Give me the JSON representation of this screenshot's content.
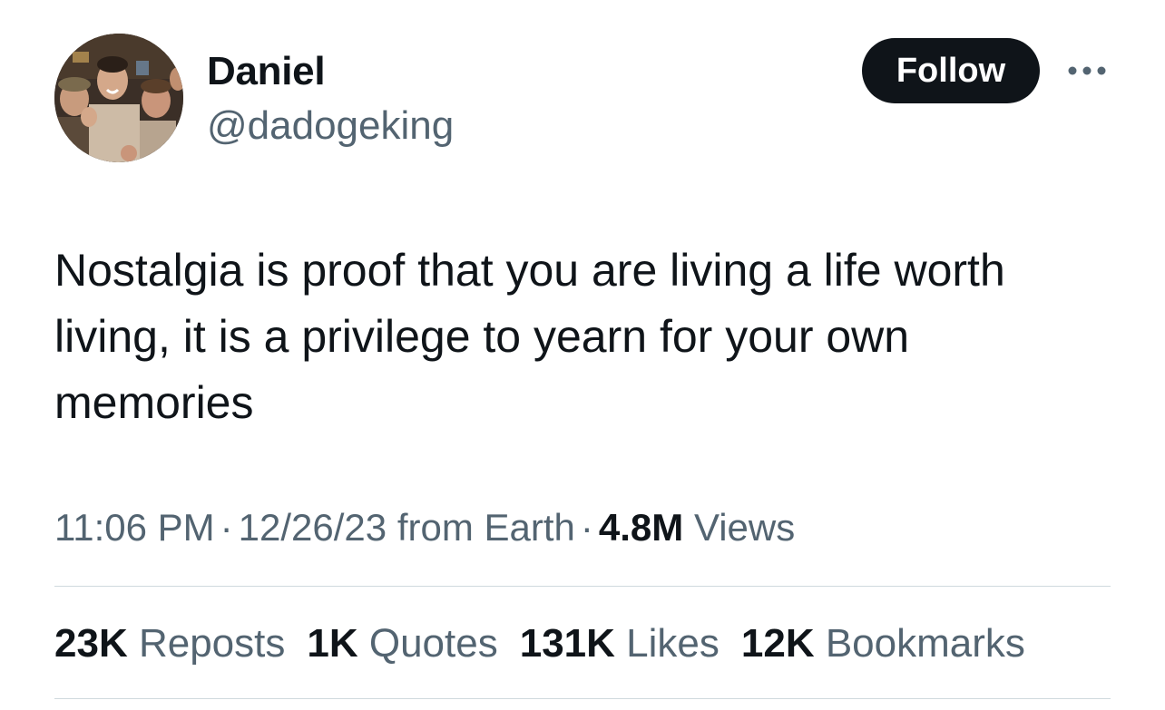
{
  "author": {
    "name": "Daniel",
    "handle": "@dadogeking"
  },
  "actions": {
    "follow_label": "Follow",
    "more_icon": "ellipsis-icon"
  },
  "tweet": {
    "text": "Nostalgia is proof that you are living a life worth living, it is a privilege to yearn for your own memories"
  },
  "meta": {
    "time": "11:06 PM",
    "separator": "·",
    "date": "12/26/23",
    "source": "from Earth",
    "views_count": "4.8M",
    "views_label": "Views"
  },
  "stats": [
    {
      "count": "23K",
      "label": "Reposts"
    },
    {
      "count": "1K",
      "label": "Quotes"
    },
    {
      "count": "131K",
      "label": "Likes"
    },
    {
      "count": "12K",
      "label": "Bookmarks"
    }
  ],
  "colors": {
    "primary_text": "#0f1419",
    "secondary_text": "#536471",
    "divider": "#cfd9de",
    "follow_bg": "#0f1419"
  }
}
